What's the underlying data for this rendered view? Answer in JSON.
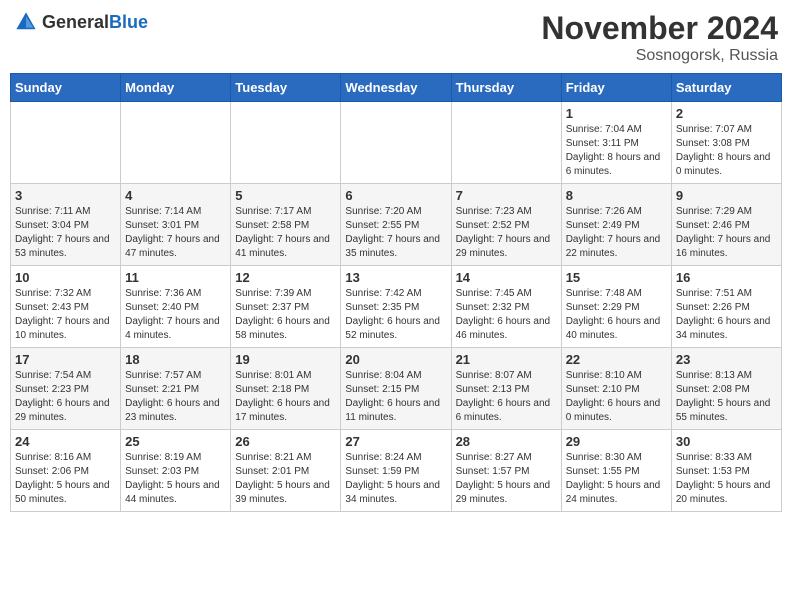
{
  "header": {
    "logo_general": "General",
    "logo_blue": "Blue",
    "month": "November 2024",
    "location": "Sosnogorsk, Russia"
  },
  "weekdays": [
    "Sunday",
    "Monday",
    "Tuesday",
    "Wednesday",
    "Thursday",
    "Friday",
    "Saturday"
  ],
  "weeks": [
    [
      {
        "day": "",
        "info": ""
      },
      {
        "day": "",
        "info": ""
      },
      {
        "day": "",
        "info": ""
      },
      {
        "day": "",
        "info": ""
      },
      {
        "day": "",
        "info": ""
      },
      {
        "day": "1",
        "info": "Sunrise: 7:04 AM\nSunset: 3:11 PM\nDaylight: 8 hours and 6 minutes."
      },
      {
        "day": "2",
        "info": "Sunrise: 7:07 AM\nSunset: 3:08 PM\nDaylight: 8 hours and 0 minutes."
      }
    ],
    [
      {
        "day": "3",
        "info": "Sunrise: 7:11 AM\nSunset: 3:04 PM\nDaylight: 7 hours and 53 minutes."
      },
      {
        "day": "4",
        "info": "Sunrise: 7:14 AM\nSunset: 3:01 PM\nDaylight: 7 hours and 47 minutes."
      },
      {
        "day": "5",
        "info": "Sunrise: 7:17 AM\nSunset: 2:58 PM\nDaylight: 7 hours and 41 minutes."
      },
      {
        "day": "6",
        "info": "Sunrise: 7:20 AM\nSunset: 2:55 PM\nDaylight: 7 hours and 35 minutes."
      },
      {
        "day": "7",
        "info": "Sunrise: 7:23 AM\nSunset: 2:52 PM\nDaylight: 7 hours and 29 minutes."
      },
      {
        "day": "8",
        "info": "Sunrise: 7:26 AM\nSunset: 2:49 PM\nDaylight: 7 hours and 22 minutes."
      },
      {
        "day": "9",
        "info": "Sunrise: 7:29 AM\nSunset: 2:46 PM\nDaylight: 7 hours and 16 minutes."
      }
    ],
    [
      {
        "day": "10",
        "info": "Sunrise: 7:32 AM\nSunset: 2:43 PM\nDaylight: 7 hours and 10 minutes."
      },
      {
        "day": "11",
        "info": "Sunrise: 7:36 AM\nSunset: 2:40 PM\nDaylight: 7 hours and 4 minutes."
      },
      {
        "day": "12",
        "info": "Sunrise: 7:39 AM\nSunset: 2:37 PM\nDaylight: 6 hours and 58 minutes."
      },
      {
        "day": "13",
        "info": "Sunrise: 7:42 AM\nSunset: 2:35 PM\nDaylight: 6 hours and 52 minutes."
      },
      {
        "day": "14",
        "info": "Sunrise: 7:45 AM\nSunset: 2:32 PM\nDaylight: 6 hours and 46 minutes."
      },
      {
        "day": "15",
        "info": "Sunrise: 7:48 AM\nSunset: 2:29 PM\nDaylight: 6 hours and 40 minutes."
      },
      {
        "day": "16",
        "info": "Sunrise: 7:51 AM\nSunset: 2:26 PM\nDaylight: 6 hours and 34 minutes."
      }
    ],
    [
      {
        "day": "17",
        "info": "Sunrise: 7:54 AM\nSunset: 2:23 PM\nDaylight: 6 hours and 29 minutes."
      },
      {
        "day": "18",
        "info": "Sunrise: 7:57 AM\nSunset: 2:21 PM\nDaylight: 6 hours and 23 minutes."
      },
      {
        "day": "19",
        "info": "Sunrise: 8:01 AM\nSunset: 2:18 PM\nDaylight: 6 hours and 17 minutes."
      },
      {
        "day": "20",
        "info": "Sunrise: 8:04 AM\nSunset: 2:15 PM\nDaylight: 6 hours and 11 minutes."
      },
      {
        "day": "21",
        "info": "Sunrise: 8:07 AM\nSunset: 2:13 PM\nDaylight: 6 hours and 6 minutes."
      },
      {
        "day": "22",
        "info": "Sunrise: 8:10 AM\nSunset: 2:10 PM\nDaylight: 6 hours and 0 minutes."
      },
      {
        "day": "23",
        "info": "Sunrise: 8:13 AM\nSunset: 2:08 PM\nDaylight: 5 hours and 55 minutes."
      }
    ],
    [
      {
        "day": "24",
        "info": "Sunrise: 8:16 AM\nSunset: 2:06 PM\nDaylight: 5 hours and 50 minutes."
      },
      {
        "day": "25",
        "info": "Sunrise: 8:19 AM\nSunset: 2:03 PM\nDaylight: 5 hours and 44 minutes."
      },
      {
        "day": "26",
        "info": "Sunrise: 8:21 AM\nSunset: 2:01 PM\nDaylight: 5 hours and 39 minutes."
      },
      {
        "day": "27",
        "info": "Sunrise: 8:24 AM\nSunset: 1:59 PM\nDaylight: 5 hours and 34 minutes."
      },
      {
        "day": "28",
        "info": "Sunrise: 8:27 AM\nSunset: 1:57 PM\nDaylight: 5 hours and 29 minutes."
      },
      {
        "day": "29",
        "info": "Sunrise: 8:30 AM\nSunset: 1:55 PM\nDaylight: 5 hours and 24 minutes."
      },
      {
        "day": "30",
        "info": "Sunrise: 8:33 AM\nSunset: 1:53 PM\nDaylight: 5 hours and 20 minutes."
      }
    ]
  ]
}
